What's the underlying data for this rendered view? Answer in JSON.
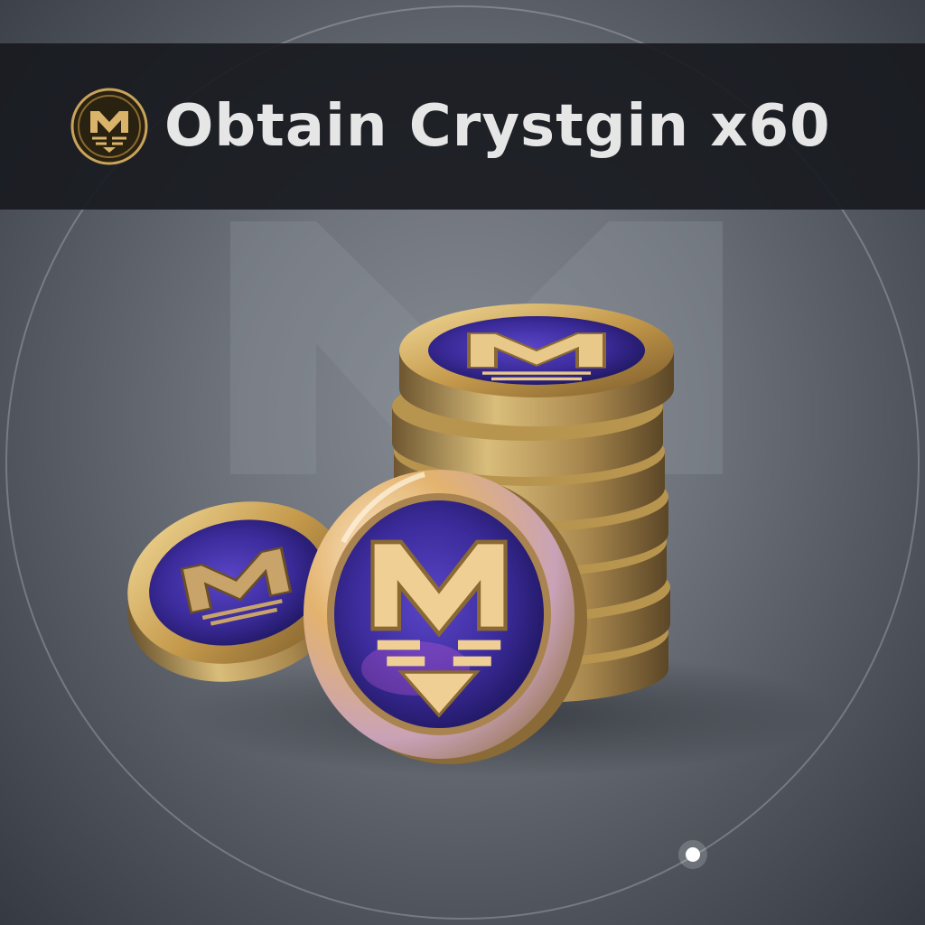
{
  "banner": {
    "title": "Obtain Crystgin x60",
    "icon": "crystgin-emblem-icon"
  },
  "item": {
    "name": "Crystgin",
    "quantity": 60,
    "image": "crystgin-coin-stack"
  },
  "colors": {
    "background": "#6f747c",
    "banner": "#181a20",
    "title_text": "#e6e6e6",
    "coin_gold": "#c9a45a",
    "coin_face": "#3b2f9a"
  }
}
